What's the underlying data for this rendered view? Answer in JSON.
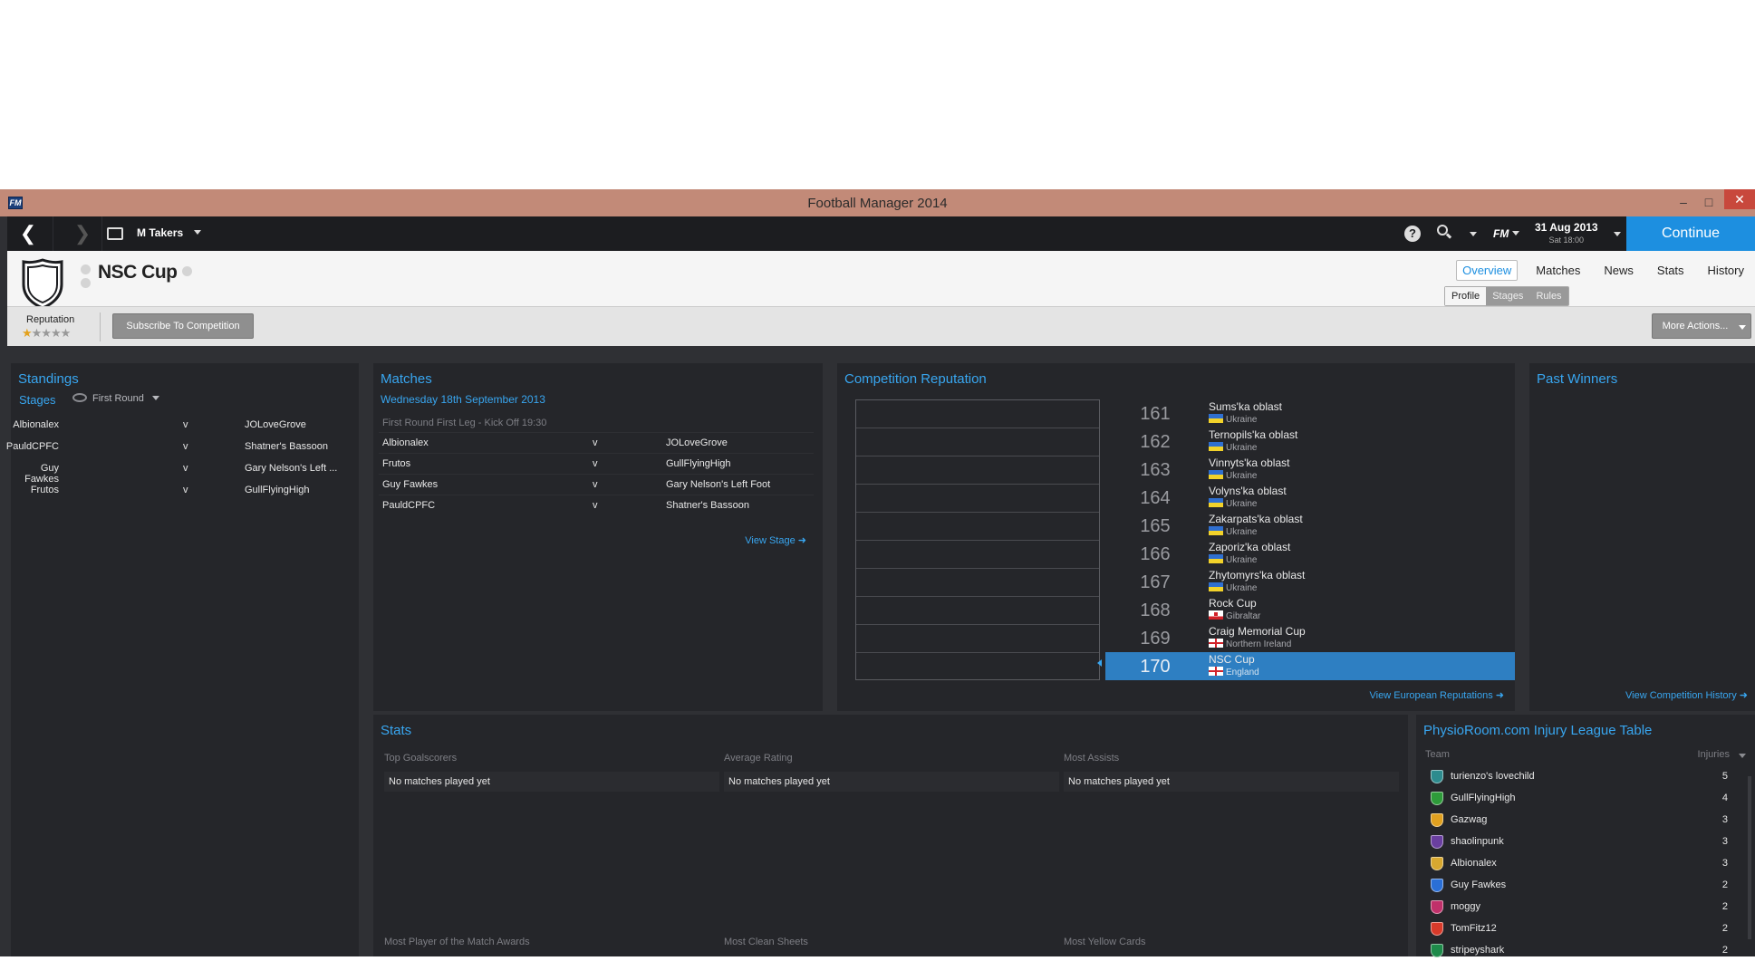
{
  "window": {
    "title": "Football Manager 2014",
    "icon": "FM"
  },
  "toolbar": {
    "manager": "M Takers",
    "fm_label": "FM",
    "date": "31 Aug 2013",
    "time": "Sat 18:00",
    "continue_label": "Continue"
  },
  "header": {
    "title": "NSC Cup",
    "tabs": [
      "Overview",
      "Matches",
      "News",
      "Stats",
      "History"
    ],
    "subtabs": [
      "Profile",
      "Stages",
      "Rules"
    ]
  },
  "infobar": {
    "reputation_label": "Reputation",
    "reputation_stars": 1,
    "reputation_max": 5,
    "subscribe_label": "Subscribe To Competition",
    "more_actions_label": "More Actions..."
  },
  "standings": {
    "title": "Standings",
    "stages_label": "Stages",
    "round_label": "First Round",
    "rows": [
      {
        "home": "Albionalex",
        "vs": "v",
        "away": "JOLoveGrove"
      },
      {
        "home": "PauldCPFC",
        "vs": "v",
        "away": "Shatner's Bassoon"
      },
      {
        "home": "Guy Fawkes",
        "vs": "v",
        "away": "Gary Nelson's Left ..."
      },
      {
        "home": "Frutos",
        "vs": "v",
        "away": "GullFlyingHigh"
      }
    ]
  },
  "matches": {
    "title": "Matches",
    "date": "Wednesday 18th September 2013",
    "subheading": "First Round First Leg - Kick Off 19:30",
    "rows": [
      {
        "home": "Albionalex",
        "vs": "v",
        "away": "JOLoveGrove"
      },
      {
        "home": "Frutos",
        "vs": "v",
        "away": "GullFlyingHigh"
      },
      {
        "home": "Guy Fawkes",
        "vs": "v",
        "away": "Gary Nelson's Left Foot"
      },
      {
        "home": "PauldCPFC",
        "vs": "v",
        "away": "Shatner's Bassoon"
      }
    ],
    "view_stage": "View Stage"
  },
  "reputation": {
    "title": "Competition Reputation",
    "rows": [
      {
        "rank": "161",
        "name": "Sums'ka oblast",
        "nation": "Ukraine",
        "flag": "ua"
      },
      {
        "rank": "162",
        "name": "Ternopils'ka oblast",
        "nation": "Ukraine",
        "flag": "ua"
      },
      {
        "rank": "163",
        "name": "Vinnyts'ka oblast",
        "nation": "Ukraine",
        "flag": "ua"
      },
      {
        "rank": "164",
        "name": "Volyns'ka oblast",
        "nation": "Ukraine",
        "flag": "ua"
      },
      {
        "rank": "165",
        "name": "Zakarpats'ka oblast",
        "nation": "Ukraine",
        "flag": "ua"
      },
      {
        "rank": "166",
        "name": "Zaporiz'ka oblast",
        "nation": "Ukraine",
        "flag": "ua"
      },
      {
        "rank": "167",
        "name": "Zhytomyrs'ka oblast",
        "nation": "Ukraine",
        "flag": "ua"
      },
      {
        "rank": "168",
        "name": "Rock Cup",
        "nation": "Gibraltar",
        "flag": "gi"
      },
      {
        "rank": "169",
        "name": "Craig Memorial Cup",
        "nation": "Northern Ireland",
        "flag": "ni"
      },
      {
        "rank": "170",
        "name": "NSC Cup",
        "nation": "England",
        "flag": "en",
        "selected": true
      }
    ],
    "view_link": "View European Reputations"
  },
  "past_winners": {
    "title": "Past Winners",
    "view_link": "View Competition History"
  },
  "stats": {
    "title": "Stats",
    "columns": [
      {
        "heading": "Top Goalscorers",
        "value": "No matches played yet"
      },
      {
        "heading": "Average Rating",
        "value": "No matches played yet"
      },
      {
        "heading": "Most Assists",
        "value": "No matches played yet"
      }
    ],
    "bottom_headings": [
      "Most Player of the Match Awards",
      "Most Clean Sheets",
      "Most Yellow Cards"
    ]
  },
  "injury": {
    "title": "PhysioRoom.com Injury League Table",
    "col_team": "Team",
    "col_injuries": "Injuries",
    "rows": [
      {
        "team": "turienzo's lovechild",
        "count": "5",
        "color": "#2d8b8e"
      },
      {
        "team": "GullFlyingHigh",
        "count": "4",
        "color": "#2e9b3a"
      },
      {
        "team": "Gazwag",
        "count": "3",
        "color": "#e0a020"
      },
      {
        "team": "shaolinpunk",
        "count": "3",
        "color": "#6a3fa0"
      },
      {
        "team": "Albionalex",
        "count": "3",
        "color": "#d8a830"
      },
      {
        "team": "Guy Fawkes",
        "count": "2",
        "color": "#2a6fd6"
      },
      {
        "team": "moggy",
        "count": "2",
        "color": "#c0306a"
      },
      {
        "team": "TomFitz12",
        "count": "2",
        "color": "#d83a2a"
      },
      {
        "team": "stripeyshark",
        "count": "2",
        "color": "#1e8a4a"
      }
    ]
  },
  "colors": {
    "accent": "#38a6f0",
    "continue": "#1d8fe0",
    "selected_row": "#2e7fc2",
    "titlebar": "#c28a78"
  }
}
